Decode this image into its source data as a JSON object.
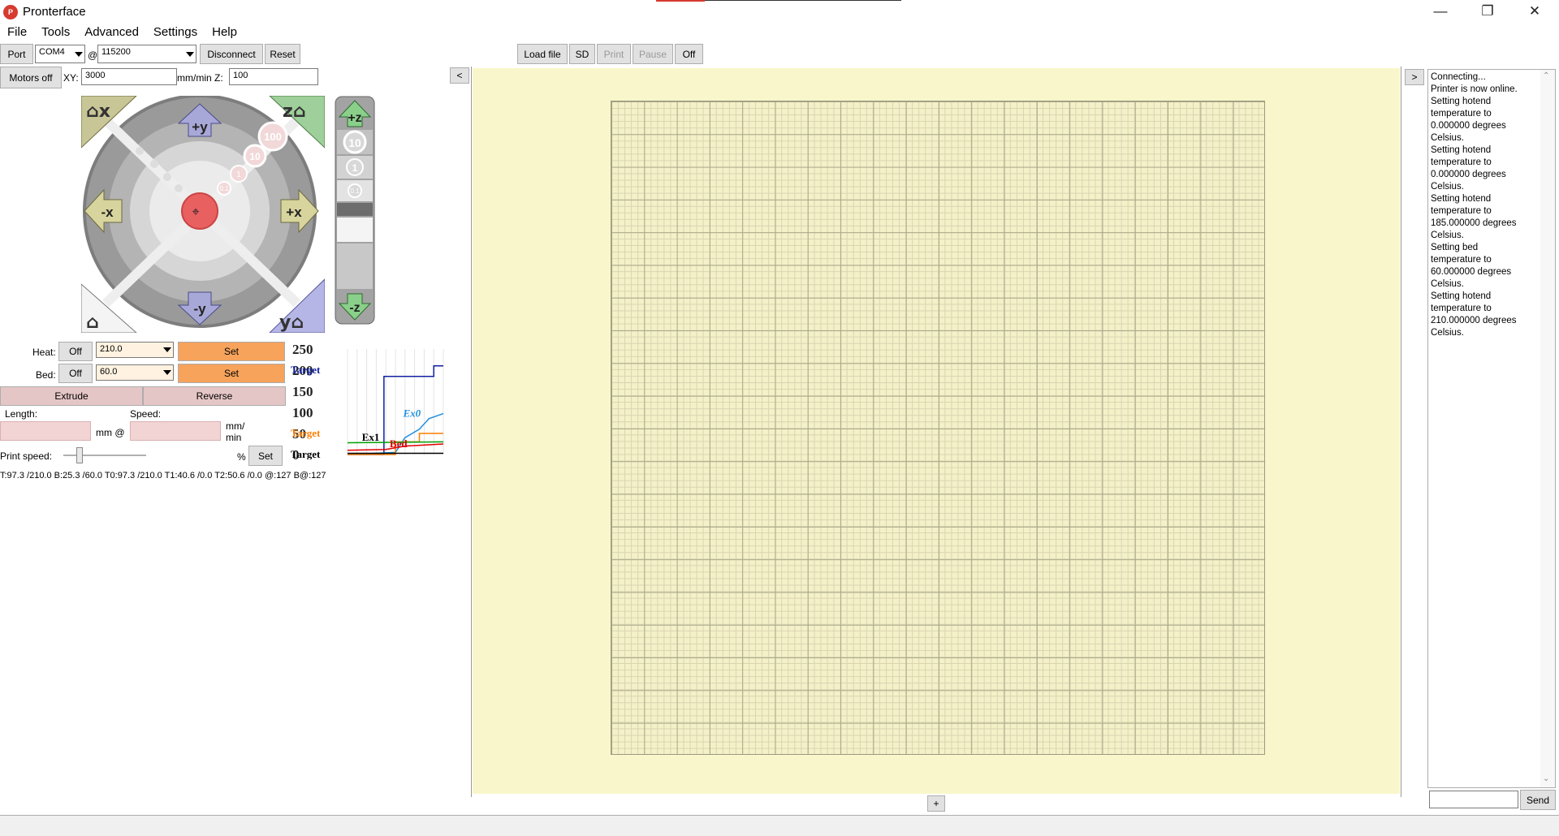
{
  "window": {
    "title": "Pronterface",
    "icon_text": "P",
    "minimize": "—",
    "maximize": "❐",
    "close": "✕"
  },
  "menu": [
    "File",
    "Tools",
    "Advanced",
    "Settings",
    "Help"
  ],
  "connection": {
    "port_label": "Port",
    "port_value": "COM4",
    "at": "@",
    "baud_value": "115200",
    "disconnect": "Disconnect",
    "reset": "Reset"
  },
  "motors": {
    "motors_off": "Motors off",
    "xy_label": "XY:",
    "xy_value": "3000",
    "unit_xy": "mm/min Z:",
    "z_value": "100"
  },
  "jog": {
    "home_x": "x",
    "home_z": "z",
    "home_y": "y",
    "plus_y": "+y",
    "minus_y": "-y",
    "plus_x": "+x",
    "minus_x": "-x",
    "steps": [
      "100",
      "10",
      "1",
      "0.1"
    ],
    "plus_z": "+z",
    "minus_z": "-z",
    "z_steps": [
      "10",
      "1",
      "0.1"
    ]
  },
  "file_toolbar": {
    "load_file": "Load file",
    "sd": "SD",
    "print": "Print",
    "pause": "Pause",
    "off": "Off"
  },
  "collapse_left": "<",
  "collapse_right": ">",
  "temps": {
    "heat_label": "Heat:",
    "heat_off": "Off",
    "heat_value": "210.0",
    "heat_set": "Set",
    "bed_label": "Bed:",
    "bed_off": "Off",
    "bed_value": "60.0",
    "bed_set": "Set",
    "extrude": "Extrude",
    "reverse": "Reverse",
    "length_label": "Length:",
    "speed_label": "Speed:",
    "mm_at": "mm @",
    "mm_per": "mm/",
    "min": "min",
    "print_speed_label": "Print speed:",
    "print_speed_value": 0.2,
    "percent": "%",
    "print_speed_set": "Set",
    "status_line": "T:97.3 /210.0 B:25.3 /60.0 T0:97.3 /210.0 T1:40.6 /0.0 T2:50.6 /0.0 @:127 B@:127"
  },
  "chart_data": {
    "type": "line",
    "title": "",
    "xlabel": "",
    "ylabel": "",
    "ylim": [
      0,
      250
    ],
    "yticks": [
      "250",
      "200",
      "150",
      "100",
      "50",
      "0"
    ],
    "labels": [
      {
        "text": "Target",
        "color": "#1020a0",
        "y": 200
      },
      {
        "text": "Target",
        "color": "#ff7f00",
        "y": 50
      },
      {
        "text": "Target",
        "color": "#000000",
        "y": 0
      },
      {
        "text": "Ex0",
        "color": "#2090e0",
        "y": 97
      },
      {
        "text": "Ex1",
        "color": "#000000",
        "y": 40
      },
      {
        "text": "Bed",
        "color": "#e00000",
        "y": 25
      }
    ],
    "series": [
      {
        "color": "#1020a0",
        "points": [
          [
            0,
            0
          ],
          [
            0.38,
            0
          ],
          [
            0.38,
            185
          ],
          [
            0.9,
            185
          ],
          [
            0.9,
            210
          ],
          [
            1,
            210
          ]
        ]
      },
      {
        "color": "#2090e0",
        "points": [
          [
            0,
            0
          ],
          [
            0.5,
            5
          ],
          [
            0.6,
            40
          ],
          [
            0.75,
            60
          ],
          [
            0.85,
            85
          ],
          [
            1,
            97
          ]
        ]
      },
      {
        "color": "#ff7f00",
        "points": [
          [
            0,
            0
          ],
          [
            0.5,
            0
          ],
          [
            0.5,
            30
          ],
          [
            0.75,
            30
          ],
          [
            0.75,
            50
          ],
          [
            1,
            50
          ]
        ]
      },
      {
        "color": "#e00000",
        "points": [
          [
            0,
            10
          ],
          [
            0.4,
            12
          ],
          [
            0.6,
            20
          ],
          [
            1,
            25
          ]
        ]
      },
      {
        "color": "#00a000",
        "points": [
          [
            0,
            28
          ],
          [
            1,
            30
          ]
        ]
      },
      {
        "color": "#000000",
        "points": [
          [
            0,
            3
          ],
          [
            1,
            3
          ]
        ]
      }
    ]
  },
  "plater": {
    "add_button": "+"
  },
  "log": {
    "lines": [
      "Connecting...",
      "Printer is now online.",
      "Setting hotend",
      "temperature to",
      "0.000000 degrees",
      "Celsius.",
      "Setting hotend",
      "temperature to",
      "0.000000 degrees",
      "Celsius.",
      "Setting hotend",
      "temperature to",
      "185.000000 degrees",
      "Celsius.",
      "Setting bed",
      "temperature to",
      "60.000000 degrees",
      "Celsius.",
      "Setting hotend",
      "temperature to",
      "210.000000 degrees",
      "Celsius."
    ],
    "send": "Send"
  },
  "colors": {
    "set_button": "#f7a35c",
    "extrude_button": "#e5c6c6",
    "plate_bg": "#f9f6cb"
  }
}
